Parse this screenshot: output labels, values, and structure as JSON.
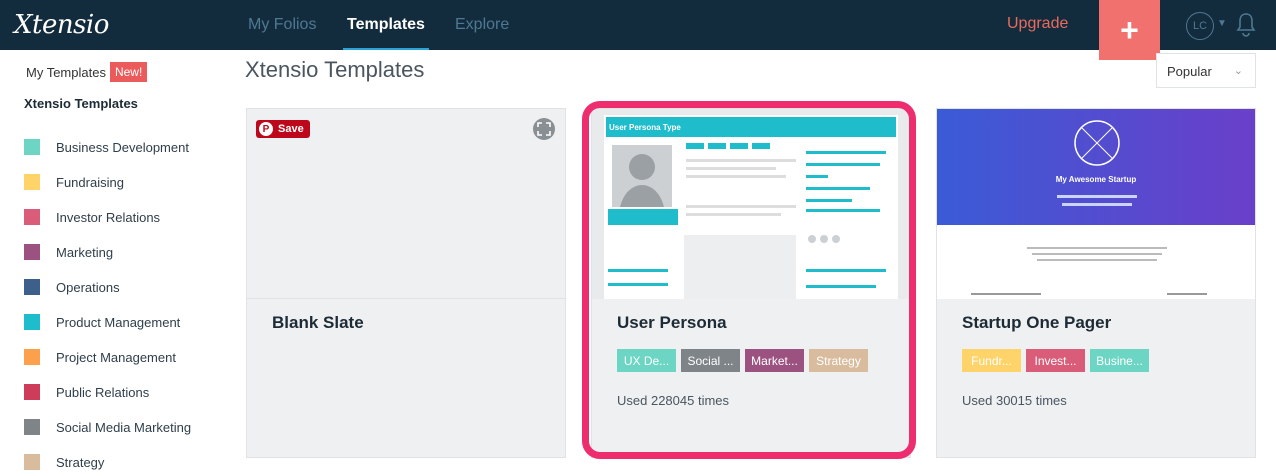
{
  "app": {
    "logo": "Xtensio"
  },
  "nav": {
    "my_folios": "My Folios",
    "templates": "Templates",
    "explore": "Explore"
  },
  "header": {
    "upgrade": "Upgrade",
    "plus": "+",
    "avatar": "LC"
  },
  "sidebar": {
    "my_templates": "My Templates",
    "new_badge": "New!",
    "xtensio_templates": "Xtensio Templates",
    "categories": [
      {
        "label": "Business Development",
        "color": "#6dd5c3"
      },
      {
        "label": "Fundraising",
        "color": "#fdd36a"
      },
      {
        "label": "Investor Relations",
        "color": "#d95d79"
      },
      {
        "label": "Marketing",
        "color": "#9b5281"
      },
      {
        "label": "Operations",
        "color": "#3e5f8a"
      },
      {
        "label": "Product Management",
        "color": "#1fbccb"
      },
      {
        "label": "Project Management",
        "color": "#fca04b"
      },
      {
        "label": "Public Relations",
        "color": "#cf3b5b"
      },
      {
        "label": "Social Media Marketing",
        "color": "#7e8488"
      },
      {
        "label": "Strategy",
        "color": "#d9bc9e"
      }
    ]
  },
  "main": {
    "title": "Xtensio Templates",
    "sort": "Popular"
  },
  "cards": [
    {
      "name": "Blank Slate",
      "save": "Save",
      "tags": [],
      "used": ""
    },
    {
      "name": "User Persona",
      "thumb_title": "User Persona Type",
      "tags": [
        {
          "label": "UX De...",
          "color": "#6dd5c3"
        },
        {
          "label": "Social ...",
          "color": "#7e8488"
        },
        {
          "label": "Market...",
          "color": "#9b5281"
        },
        {
          "label": "Strategy",
          "color": "#d9bc9e"
        }
      ],
      "used": "Used 228045 times"
    },
    {
      "name": "Startup One Pager",
      "thumb_title": "My Awesome Startup",
      "tags": [
        {
          "label": "Fundr...",
          "color": "#fdd36a"
        },
        {
          "label": "Invest...",
          "color": "#d95d79"
        },
        {
          "label": "Busine...",
          "color": "#6dd5c3"
        }
      ],
      "used": "Used 30015 times"
    }
  ]
}
